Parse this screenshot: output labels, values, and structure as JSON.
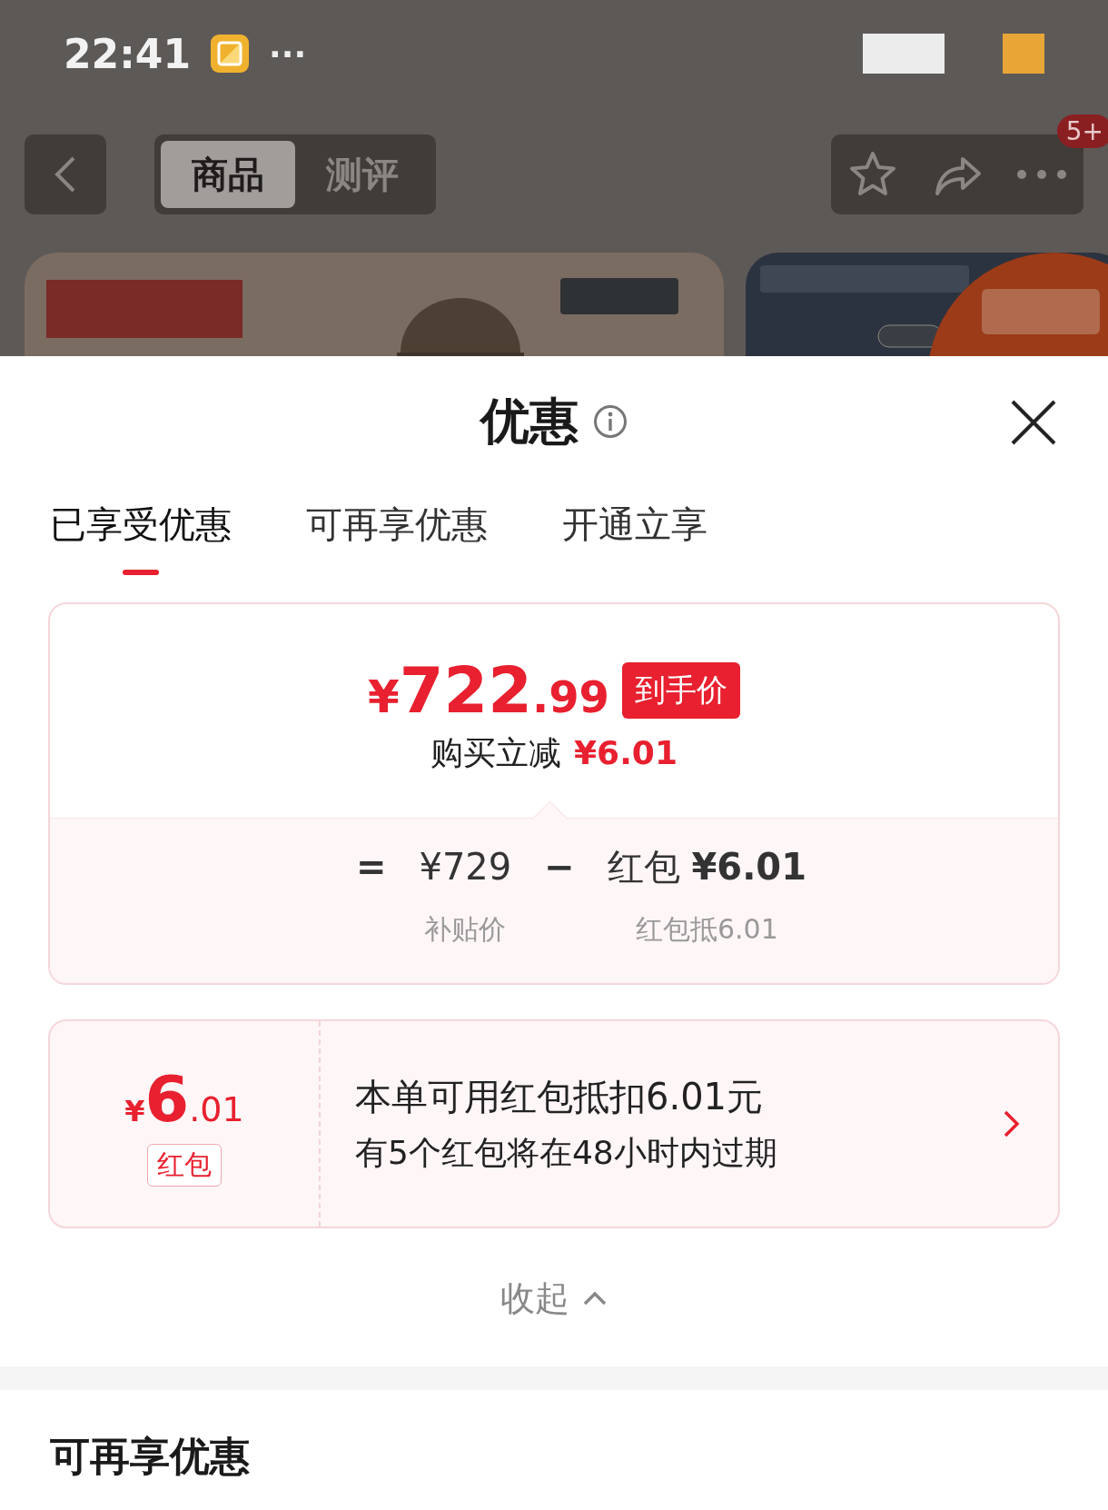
{
  "status_bar": {
    "time": "22:41",
    "more": "···"
  },
  "nav": {
    "tabs": [
      {
        "label": "商品",
        "selected": true
      },
      {
        "label": "测评",
        "selected": false
      }
    ],
    "badge": "5+"
  },
  "sheet": {
    "title": "优惠",
    "tabs": [
      {
        "label": "已享受优惠",
        "selected": true
      },
      {
        "label": "可再享优惠",
        "selected": false
      },
      {
        "label": "开通立享",
        "selected": false
      }
    ],
    "price": {
      "currency": "¥",
      "integer": "722",
      "decimal": ".99",
      "badge": "到手价",
      "saving_label": "购买立减",
      "saving_value": "¥6.01"
    },
    "breakdown": [
      {
        "kind": "operator",
        "text": "="
      },
      {
        "kind": "term",
        "value": "¥729",
        "label": "补贴价"
      },
      {
        "kind": "operator",
        "text": "−"
      },
      {
        "kind": "term",
        "value": "红包 **¥6.01**",
        "label": "红包抵6.01"
      }
    ],
    "coupon": {
      "currency": "¥",
      "integer": "6",
      "decimal": ".01",
      "tag": "红包",
      "title": "本单可用红包抵扣6.01元",
      "subtitle": "有5个红包将在48小时内过期"
    },
    "collapse": "收起"
  },
  "section_title": "可再享优惠"
}
